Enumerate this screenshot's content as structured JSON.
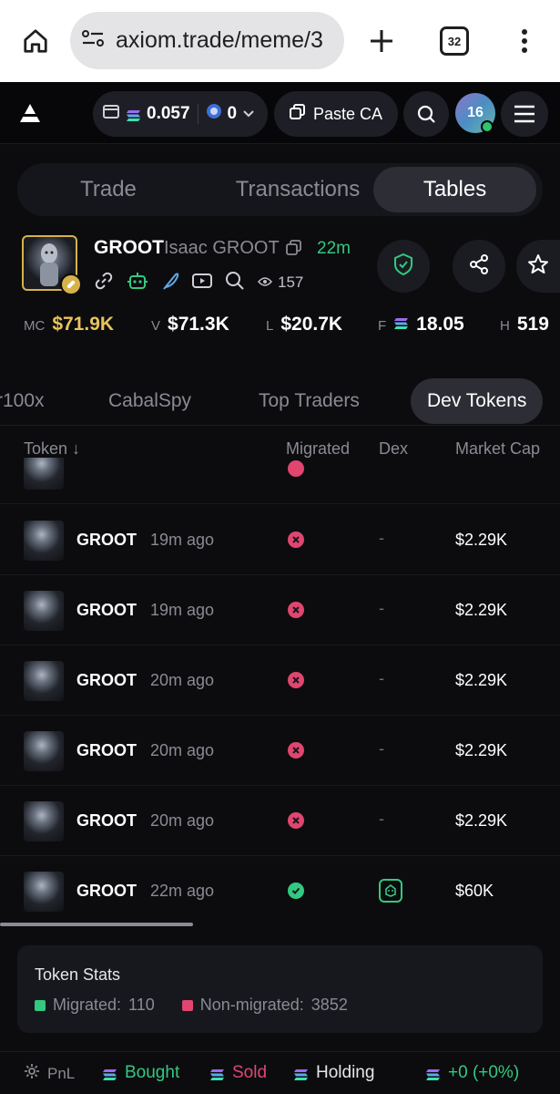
{
  "browser": {
    "url": "axiom.trade/meme/3",
    "tab_count": "32"
  },
  "header": {
    "sol_balance": "0.057",
    "secondary_balance": "0",
    "paste_label": "Paste CA",
    "avatar_label": "16"
  },
  "segments": [
    "Trade",
    "Transactions",
    "Tables"
  ],
  "token": {
    "ticker": "GROOT",
    "name": "Isaac GROOT",
    "age": "22m",
    "views": "157"
  },
  "metrics": [
    {
      "label": "MC",
      "value": "$71.9K",
      "color": "#e8c45c"
    },
    {
      "label": "V",
      "value": "$71.3K",
      "color": "#ffffff"
    },
    {
      "label": "L",
      "value": "$20.7K",
      "color": "#ffffff"
    },
    {
      "label": "F",
      "value": "18.05",
      "color": "#ffffff"
    },
    {
      "label": "H",
      "value": "519",
      "color": "#ffffff"
    }
  ],
  "subtabs": [
    "r100x",
    "CabalSpy",
    "Top Traders",
    "Dev Tokens"
  ],
  "table": {
    "columns": [
      "Token ↓",
      "Migrated",
      "Dex",
      "Market Cap"
    ],
    "rows": [
      {
        "name": "GROOT",
        "age": "19m ago",
        "migrated": false,
        "dex": "-",
        "mc": "$2.29K"
      },
      {
        "name": "GROOT",
        "age": "19m ago",
        "migrated": false,
        "dex": "-",
        "mc": "$2.29K"
      },
      {
        "name": "GROOT",
        "age": "20m ago",
        "migrated": false,
        "dex": "-",
        "mc": "$2.29K"
      },
      {
        "name": "GROOT",
        "age": "20m ago",
        "migrated": false,
        "dex": "-",
        "mc": "$2.29K"
      },
      {
        "name": "GROOT",
        "age": "20m ago",
        "migrated": false,
        "dex": "-",
        "mc": "$2.29K"
      },
      {
        "name": "GROOT",
        "age": "22m ago",
        "migrated": true,
        "dex": "pump-icon",
        "mc": "$60K"
      }
    ]
  },
  "stats": {
    "title": "Token Stats",
    "migrated_label": "Migrated:",
    "migrated_value": "110",
    "non_migrated_label": "Non-migrated:",
    "non_migrated_value": "3852"
  },
  "bottom": {
    "pnl": "PnL",
    "bought": "Bought",
    "sold": "Sold",
    "holding": "Holding",
    "pnl_value": "+0 (+0%)"
  },
  "colors": {
    "green": "#33c980",
    "red": "#e0466f",
    "gold": "#e8c45c"
  }
}
